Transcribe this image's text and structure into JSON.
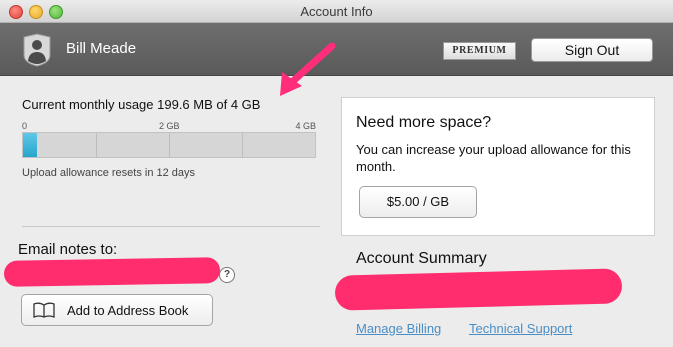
{
  "window": {
    "title": "Account Info"
  },
  "header": {
    "user_name": "Bill Meade",
    "badge": "PREMIUM",
    "sign_out_label": "Sign Out"
  },
  "usage": {
    "label": "Current monthly usage 199.6 MB of 4 GB",
    "ticks": [
      "0",
      "2 GB",
      "4 GB"
    ],
    "fill_fraction": 0.049,
    "reset_text": "Upload allowance resets in 12 days",
    "accent_color": "#2ba7cf"
  },
  "email": {
    "label": "Email notes to:",
    "help_glyph": "?",
    "add_book_label": "Add to Address Book",
    "redact_color": "#ff2d6e"
  },
  "more_space": {
    "title": "Need more space?",
    "body": "You can increase your upload allowance for this month.",
    "price_label": "$5.00 / GB"
  },
  "summary": {
    "title": "Account Summary",
    "links": {
      "billing": "Manage Billing",
      "support": "Technical Support"
    }
  },
  "icons": {
    "avatar": "user-silhouette-icon",
    "address_book": "open-book-icon",
    "arrow": "pink-arrow-annotation"
  }
}
